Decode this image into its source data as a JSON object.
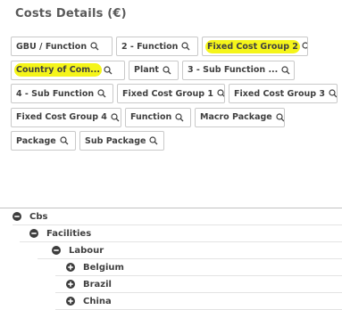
{
  "panel": {
    "title": "Costs Details (€)"
  },
  "filters": [
    [
      {
        "label": "GBU / Function",
        "highlight": false
      },
      {
        "label": "2 - Function",
        "highlight": false
      },
      {
        "label": "Fixed Cost Group 2",
        "highlight": true
      }
    ],
    [
      {
        "label": "Country of Com...",
        "highlight": true
      },
      {
        "label": "Plant",
        "highlight": false
      },
      {
        "label": "3 - Sub Function ...",
        "highlight": false
      }
    ],
    [
      {
        "label": "4 - Sub Function",
        "highlight": false
      },
      {
        "label": "Fixed Cost Group 1",
        "highlight": false
      },
      {
        "label": "Fixed Cost Group 3",
        "highlight": false
      }
    ],
    [
      {
        "label": "Fixed Cost Group 4",
        "highlight": false
      },
      {
        "label": "Function",
        "highlight": false
      },
      {
        "label": "Macro Package",
        "highlight": false
      }
    ],
    [
      {
        "label": "Package",
        "highlight": false
      },
      {
        "label": "Sub Package",
        "highlight": false
      }
    ]
  ],
  "tree": {
    "root": {
      "label": "Cbs",
      "state": "expanded"
    },
    "facilities": {
      "label": "Facilities",
      "state": "expanded"
    },
    "labour": {
      "label": "Labour",
      "state": "expanded"
    },
    "countries": [
      {
        "label": "Belgium",
        "state": "collapsed"
      },
      {
        "label": "Brazil",
        "state": "collapsed"
      },
      {
        "label": "China",
        "state": "collapsed"
      }
    ]
  },
  "colors": {
    "highlight": "#f5f51a",
    "text": "#404040",
    "border": "#c9c9c9"
  },
  "icons": {
    "search": "search-icon",
    "expanded": "minus-circle-icon",
    "collapsed": "plus-circle-icon"
  }
}
